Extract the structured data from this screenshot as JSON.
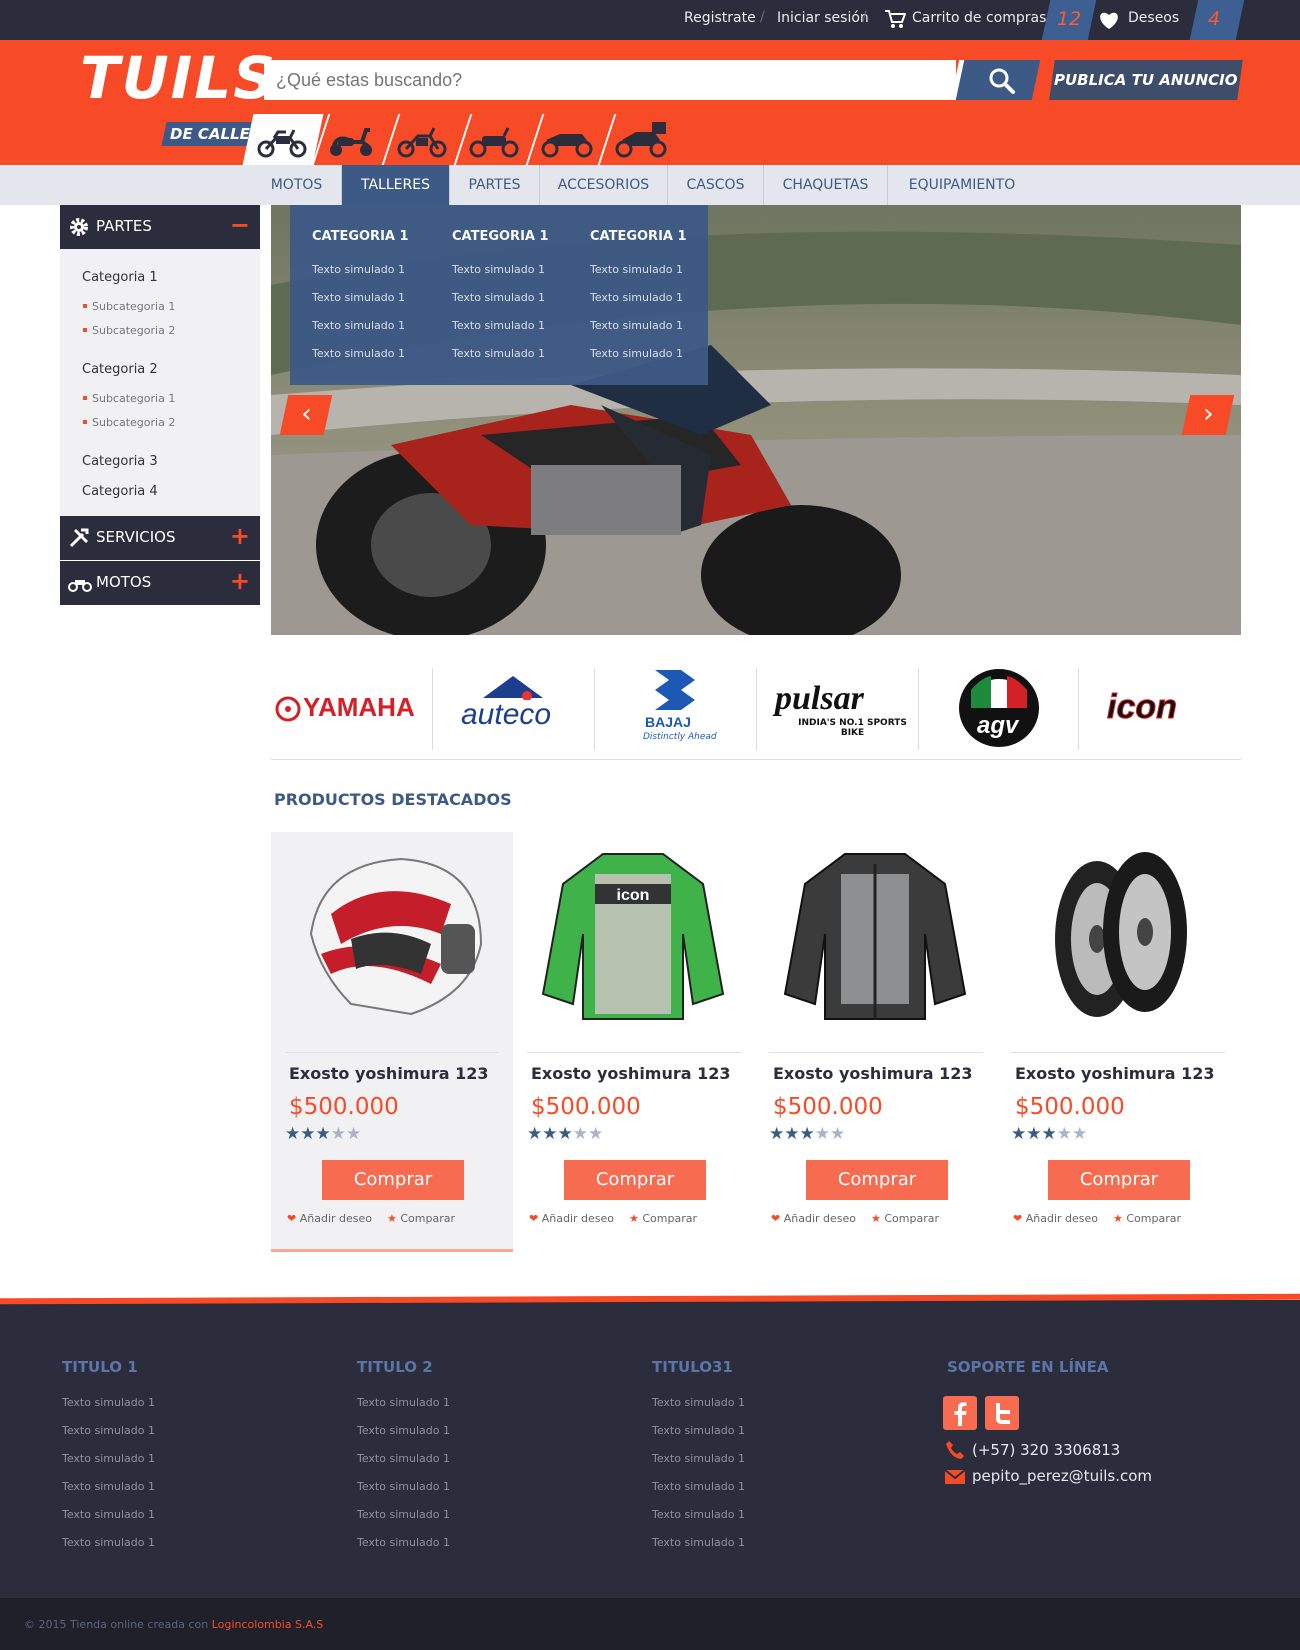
{
  "topbar": {
    "register": "Registrate",
    "login": "Iniciar sesión",
    "cart_label": "Carrito de compras",
    "cart_count": "12",
    "wishlist_label": "Deseos",
    "wishlist_count": "4"
  },
  "header": {
    "logo": "TUILS",
    "search_placeholder": "¿Qué estas buscando?",
    "publish": "PUBLICA TU ANUNCIO",
    "moto_category_label": "DE CALLE"
  },
  "nav": {
    "items": [
      "MOTOS",
      "TALLERES",
      "PARTES",
      "ACCESORIOS",
      "CASCOS",
      "CHAQUETAS",
      "EQUIPAMIENTO"
    ],
    "active": "TALLERES"
  },
  "dropdown": {
    "columns": [
      {
        "title": "CATEGORIA 1",
        "items": [
          "Texto simulado 1",
          "Texto simulado 1",
          "Texto simulado 1",
          "Texto simulado 1"
        ]
      },
      {
        "title": "CATEGORIA 1",
        "items": [
          "Texto simulado 1",
          "Texto simulado 1",
          "Texto simulado 1",
          "Texto simulado 1"
        ]
      },
      {
        "title": "CATEGORIA 1",
        "items": [
          "Texto simulado 1",
          "Texto simulado 1",
          "Texto simulado 1",
          "Texto simulado 1"
        ]
      }
    ]
  },
  "sidebar": {
    "sections": [
      {
        "label": "PARTES",
        "toggle": "−",
        "icon": "gear-icon"
      },
      {
        "label": "SERVICIOS",
        "toggle": "+",
        "icon": "tools-icon"
      },
      {
        "label": "MOTOS",
        "toggle": "+",
        "icon": "motorcycle-icon"
      }
    ],
    "categories": [
      {
        "label": "Categoria 1",
        "subs": [
          "Subcategoria 1",
          "Subcategoria 2"
        ]
      },
      {
        "label": "Categoria 2",
        "subs": [
          "Subcategoria 1",
          "Subcategoria 2"
        ]
      },
      {
        "label": "Categoria 3",
        "subs": []
      },
      {
        "label": "Categoria 4",
        "subs": []
      }
    ]
  },
  "brands": [
    "YAMAHA",
    "auteco",
    "BAJAJ",
    "pulsar",
    "agv",
    "icon"
  ],
  "brand_subtexts": {
    "bajaj": "Distinctly Ahead",
    "pulsar": "INDIA'S NO.1 SPORTS BIKE"
  },
  "products": {
    "title": "PRODUCTOS DESTACADOS",
    "items": [
      {
        "name": "Exosto yoshimura 123",
        "price": "$500.000",
        "rating": 3,
        "buy": "Comprar",
        "wish": "Añadir deseo",
        "compare": "Comparar",
        "image": "helmet"
      },
      {
        "name": "Exosto yoshimura 123",
        "price": "$500.000",
        "rating": 3,
        "buy": "Comprar",
        "wish": "Añadir deseo",
        "compare": "Comparar",
        "image": "green-jacket"
      },
      {
        "name": "Exosto yoshimura 123",
        "price": "$500.000",
        "rating": 3,
        "buy": "Comprar",
        "wish": "Añadir deseo",
        "compare": "Comparar",
        "image": "grey-jacket"
      },
      {
        "name": "Exosto yoshimura 123",
        "price": "$500.000",
        "rating": 3,
        "buy": "Comprar",
        "wish": "Añadir deseo",
        "compare": "Comparar",
        "image": "tires"
      }
    ]
  },
  "footer": {
    "columns": [
      {
        "title": "TITULO 1",
        "links": [
          "Texto simulado 1",
          "Texto simulado 1",
          "Texto simulado 1",
          "Texto simulado 1",
          "Texto simulado 1",
          "Texto simulado 1"
        ]
      },
      {
        "title": "TITULO 2",
        "links": [
          "Texto simulado 1",
          "Texto simulado 1",
          "Texto simulado 1",
          "Texto simulado 1",
          "Texto simulado 1",
          "Texto simulado 1"
        ]
      },
      {
        "title": "TITULO31",
        "links": [
          "Texto simulado 1",
          "Texto simulado 1",
          "Texto simulado 1",
          "Texto simulado 1",
          "Texto simulado 1",
          "Texto simulado 1"
        ]
      }
    ],
    "support_title": "SOPORTE EN LÍNEA",
    "phone": "(+57) 320 3306813",
    "email": "pepito_perez@tuils.com",
    "copyright_prefix": "© 2015 Tienda online creada con ",
    "copyright_company": "Logincolombia S.A.S"
  },
  "colors": {
    "accent": "#f74b28",
    "navy": "#3d5a86",
    "dark": "#2b2d3c"
  }
}
